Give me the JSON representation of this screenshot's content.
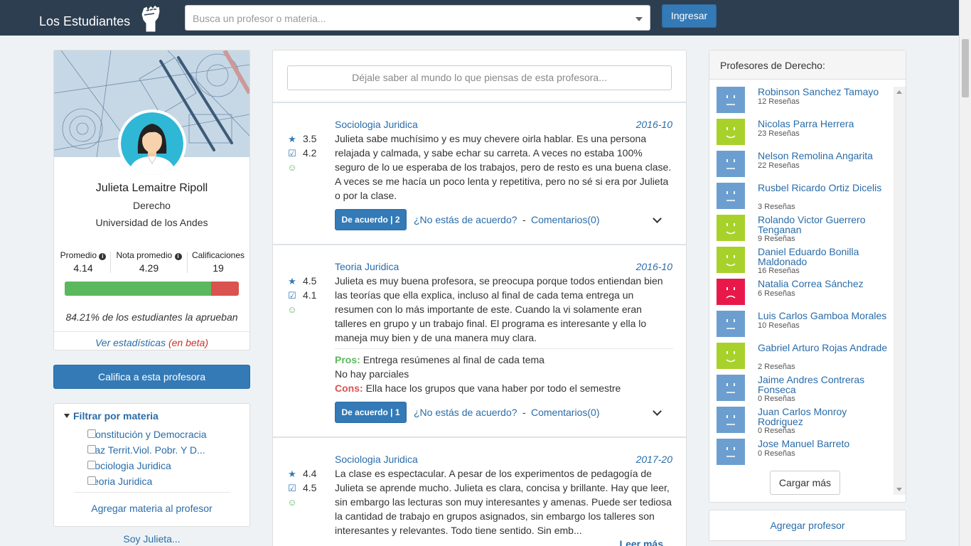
{
  "navbar": {
    "brand": "Los Estudiantes",
    "search_placeholder": "Busca un profesor o materia...",
    "login_label": "Ingresar"
  },
  "profile": {
    "name": "Julieta Lemaitre Ripoll",
    "department": "Derecho",
    "university": "Universidad de los Andes",
    "stats": [
      {
        "label": "Promedio",
        "value": "4.14",
        "info": true
      },
      {
        "label": "Nota promedio",
        "value": "4.29",
        "info": true
      },
      {
        "label": "Calificaciones",
        "value": "19",
        "info": false
      }
    ],
    "approval_fraction": 0.8421,
    "approval_text": "84.21% de los estudiantes la aprueban",
    "stats_link": "Ver estadísticas",
    "stats_beta": "(en beta)"
  },
  "rate_button": "Califica a esta profesora",
  "filter": {
    "title": "Filtrar por materia",
    "items": [
      "Constitución y Democracia",
      "Paz Territ.Viol. Pobr. Y D...",
      "Sociologia Juridica",
      "Teoria Juridica"
    ],
    "add_subject": "Agregar materia al profesor"
  },
  "soy_link": "Soy Julieta...",
  "opinion_placeholder": "Déjale saber al mundo lo que piensas de esta profesora...",
  "reviews": [
    {
      "course": "Sociologia Juridica",
      "date": "2016-10",
      "score1": "3.5",
      "score2": "4.2",
      "text": "Julieta sabe muchísimo y es muy chevere oirla hablar. Es una persona relajada y calmada, y sabe echar su carreta. A veces no estaba 100% seguro de lo ue esperaba de los trabajos, pero de resto es una buena clase. A veces se me hacía un poco lenta y repetitiva, pero no sé si era por Julieta o por la clase.",
      "agree": "De acuerdo | 2",
      "disagree": "¿No estás de acuerdo?",
      "dash": "-",
      "comments": "Comentarios(0)"
    },
    {
      "course": "Teoria Juridica",
      "date": "2016-10",
      "score1": "4.5",
      "score2": "4.1",
      "text": "Julieta es muy buena profesora, se preocupa porque todos entiendan bien las teorías que ella explica, incluso al final de cada tema entrega un resumen con lo más importante de este. Cuando la vi solamente eran talleres en grupo y un trabajo final. El programa es interesante y ella lo maneja muy bien y de una manera muy clara.",
      "pros_label": "Pros:",
      "pros": "Entrega resúmenes al final de cada tema",
      "pros2": "No hay parciales",
      "cons_label": "Cons:",
      "cons": "Ella hace los grupos que vana haber por todo el semestre",
      "agree": "De acuerdo | 1",
      "disagree": "¿No estás de acuerdo?",
      "dash": "-",
      "comments": "Comentarios(0)"
    },
    {
      "course": "Sociologia Juridica",
      "date": "2017-20",
      "score1": "4.4",
      "score2": "4.5",
      "text": "La clase es espectacular. A pesar de los experimentos de pedagogía de Julieta se aprende mucho. Julieta es clara, concisa y brillante. Hay que leer, sin embargo las lecturas son muy interesantes y amenas. Puede ser tediosa la cantidad de trabajo en grupos asignados, sin embargo los talleres son interesantes y relevantes. Todo tiene sentido. Sin emb...",
      "read_more": "Leer más"
    }
  ],
  "right": {
    "title": "Profesores de Derecho:",
    "professors": [
      {
        "name": "Robinson Sanchez Tamayo",
        "reviews": "12 Reseñas",
        "mood": "neutral"
      },
      {
        "name": "Nicolas Parra Herrera",
        "reviews": "23 Reseñas",
        "mood": "happy"
      },
      {
        "name": "Nelson Remolina Angarita",
        "reviews": "22 Reseñas",
        "mood": "neutral"
      },
      {
        "name": "Rusbel Ricardo Ortiz Dicelis",
        "reviews": "3 Reseñas",
        "mood": "neutral"
      },
      {
        "name": "Rolando Victor Guerrero Tenganan",
        "reviews": "9 Reseñas",
        "mood": "happy"
      },
      {
        "name": "Daniel Eduardo Bonilla Maldonado",
        "reviews": "16 Reseñas",
        "mood": "happy"
      },
      {
        "name": "Natalia Correa Sánchez",
        "reviews": "6 Reseñas",
        "mood": "sad"
      },
      {
        "name": "Luis Carlos Gamboa Morales",
        "reviews": "10 Reseñas",
        "mood": "neutral"
      },
      {
        "name": "Gabriel Arturo Rojas Andrade",
        "reviews": "2 Reseñas",
        "mood": "happy"
      },
      {
        "name": "Jaime Andres Contreras Fonseca",
        "reviews": "0 Reseñas",
        "mood": "neutral"
      },
      {
        "name": "Juan Carlos Monroy Rodriguez",
        "reviews": "0 Reseñas",
        "mood": "neutral"
      },
      {
        "name": "Jose Manuel Barreto",
        "reviews": "0 Reseñas",
        "mood": "neutral"
      }
    ],
    "load_more": "Cargar más"
  },
  "add_professor": "Agregar profesor",
  "colors": {
    "navbar": "#2d3e50",
    "primary": "#337ab7",
    "link": "#2a6ca8",
    "approve_green": "#5cb85c",
    "disapprove_red": "#d9534f",
    "face_neutral": "#6c9fd0",
    "face_happy": "#a8d12c",
    "face_sad": "#e8194a"
  }
}
